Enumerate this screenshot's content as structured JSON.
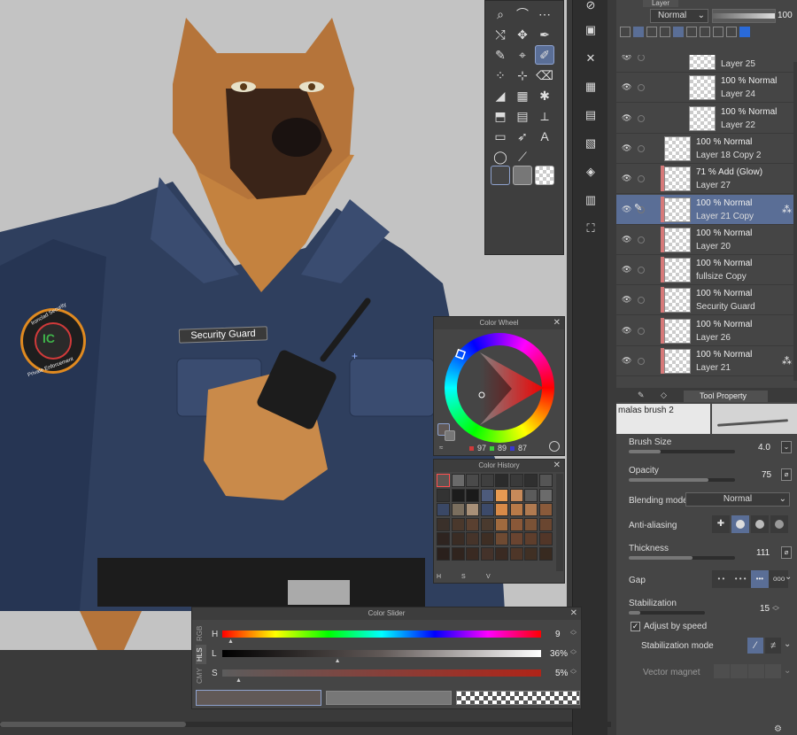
{
  "canvas": {
    "patch_line1": "Ironclad Security",
    "patch_line2": "Private Enforcement",
    "patch_mark": "IC",
    "name_tag": "Security Guard"
  },
  "tool_palette": {
    "icons": [
      "magnifier-icon",
      "lasso-icon",
      "dotted-lasso-icon",
      "auto-select-icon",
      "move-icon",
      "eyedropper-icon",
      "pen-icon",
      "airbrush-icon",
      "pencil-icon",
      "spray-icon",
      "blend-icon",
      "eraser-icon",
      "fill-icon",
      "gradient-icon",
      "sparkle-icon",
      "bucket-icon",
      "grid-icon",
      "ruler-icon",
      "frame-icon",
      "arrow-icon",
      "text-icon",
      "balloon-icon",
      "line-tool-icon"
    ],
    "text_tool_label": "A"
  },
  "side_toolbar": {
    "icons": [
      "navigator-icon",
      "layer-panel-icon",
      "close-panel-icon",
      "material-icon",
      "history-icon",
      "item-bank-icon",
      "sub-view-icon",
      "animation-icon",
      "timeline-icon"
    ]
  },
  "layer_panel": {
    "title": "Layer",
    "blend_mode": "Normal",
    "opacity": "100",
    "layers": [
      {
        "opacity_mode": "",
        "name": "Layer 25",
        "indent": 2,
        "selected": false,
        "mark": false
      },
      {
        "opacity_mode": "100 % Normal",
        "name": "Layer 24",
        "indent": 2,
        "selected": false,
        "mark": false
      },
      {
        "opacity_mode": "100 % Normal",
        "name": "Layer 22",
        "indent": 2,
        "selected": false,
        "mark": false
      },
      {
        "opacity_mode": "100 % Normal",
        "name": "Layer 18 Copy 2",
        "indent": 1,
        "selected": false,
        "mark": false
      },
      {
        "opacity_mode": "71 % Add (Glow)",
        "name": "Layer 27",
        "indent": 1,
        "selected": false,
        "mark": true
      },
      {
        "opacity_mode": "100 % Normal",
        "name": "Layer 21 Copy",
        "indent": 1,
        "selected": true,
        "mark": true
      },
      {
        "opacity_mode": "100 % Normal",
        "name": "Layer 20",
        "indent": 1,
        "selected": false,
        "mark": true
      },
      {
        "opacity_mode": "100 % Normal",
        "name": "fullsize Copy",
        "indent": 1,
        "selected": false,
        "mark": true
      },
      {
        "opacity_mode": "100 % Normal",
        "name": "Security Guard",
        "indent": 1,
        "selected": false,
        "mark": true
      },
      {
        "opacity_mode": "100 % Normal",
        "name": "Layer 26",
        "indent": 1,
        "selected": false,
        "mark": true
      },
      {
        "opacity_mode": "100 % Normal",
        "name": "Layer 21",
        "indent": 1,
        "selected": false,
        "mark": true
      }
    ]
  },
  "tool_property": {
    "tab_label": "Tool Property",
    "brush_name": "malas brush 2",
    "brush_size_label": "Brush Size",
    "brush_size_value": "4.0",
    "brush_size_level": 0.3,
    "opacity_label": "Opacity",
    "opacity_value": "75",
    "opacity_level": 0.75,
    "blending_label": "Blending mode",
    "blending_value": "Normal",
    "antialias_label": "Anti-aliasing",
    "thickness_label": "Thickness",
    "thickness_value": "111",
    "thickness_level": 0.6,
    "gap_label": "Gap",
    "stabilization_label": "Stabilization",
    "stabilization_value": "15",
    "stabilization_level": 0.15,
    "adjust_speed_label": "Adjust by speed",
    "stabilization_mode_label": "Stabilization mode",
    "vector_magnet_label": "Vector magnet"
  },
  "color_wheel": {
    "title": "Color Wheel",
    "r": "97",
    "g": "89",
    "b": "87"
  },
  "color_history": {
    "title": "Color History",
    "swatches": [
      "#5c5552",
      "#6a6a6a",
      "#4a4a4a",
      "#3f3f3f",
      "#2b2b2b",
      "#3a3a3a",
      "#2f2f2f",
      "#555555",
      "#333333",
      "#1c1c1c",
      "#1a1a1a",
      "#4d5b7c",
      "#e79a52",
      "#c78a5a",
      "#5b5b5b",
      "#6b6b6b",
      "#3a4866",
      "#7a6e5e",
      "#a89078",
      "#3c4a6a",
      "#d88a48",
      "#b97a48",
      "#b07a50",
      "#8a5a3a",
      "#3a302a",
      "#4a382c",
      "#5a4030",
      "#4a3a2e",
      "#a06a3e",
      "#8a5838",
      "#7a5236",
      "#6a4630",
      "#2e2420",
      "#3a2c24",
      "#46342a",
      "#3e2e24",
      "#6e4a32",
      "#6a4430",
      "#5e3e2c",
      "#523628",
      "#2a201c",
      "#30241e",
      "#3a2a22",
      "#44322a",
      "#3a2a22",
      "#4e3628",
      "#403024",
      "#382a20"
    ]
  },
  "color_slider": {
    "title": "Color Slider",
    "h_label": "H",
    "l_label": "L",
    "s_label": "S",
    "h_value": "9",
    "l_value": "36%",
    "s_value": "5%",
    "h_level": 0.025,
    "l_level": 0.36,
    "s_level": 0.05,
    "mode_rgb": "RGB",
    "mode_hls": "HLS",
    "mode_cmyk": "CMY"
  },
  "colors": {
    "accent": "#5a6e96",
    "main_color": "#615957",
    "sub_color": "#777777",
    "uniform": "#2e3d5a",
    "fur": "#b5743a"
  }
}
